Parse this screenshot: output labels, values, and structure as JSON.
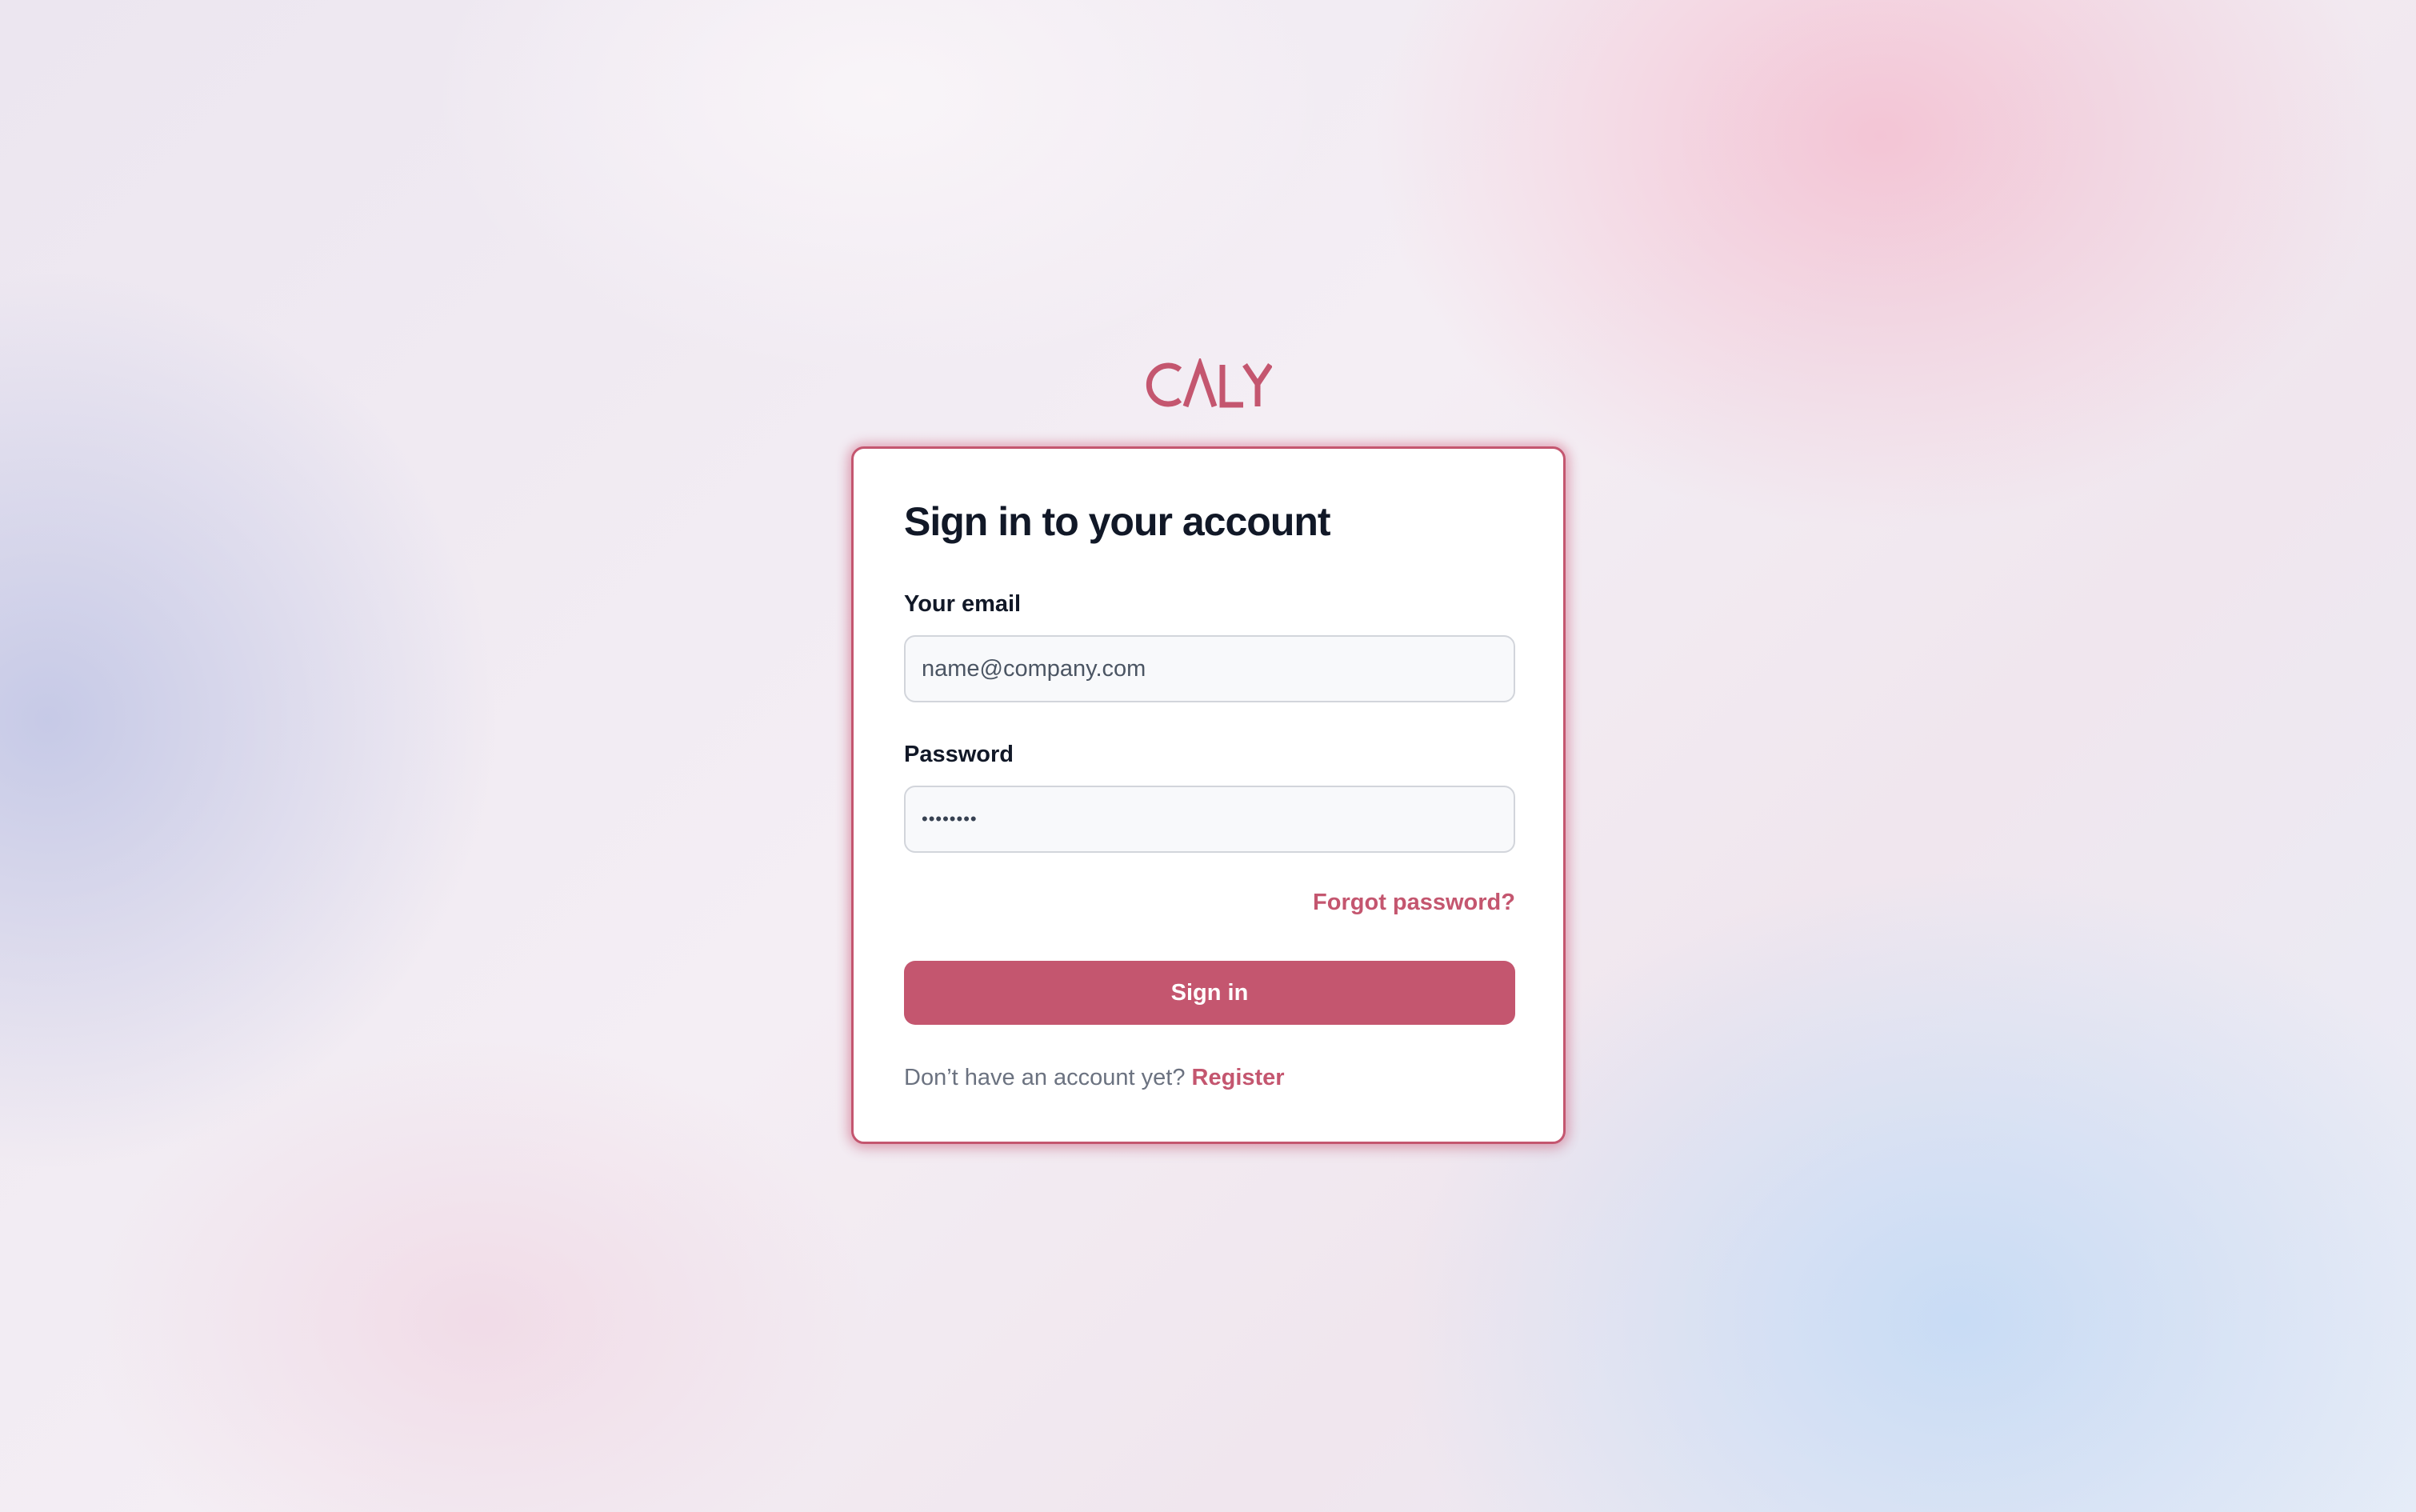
{
  "brand": {
    "logo_text": "CALY",
    "accent_color": "#c4566f"
  },
  "login": {
    "title": "Sign in to your account",
    "email_label": "Your email",
    "email_placeholder": "name@company.com",
    "password_label": "Password",
    "password_value": "••••••••",
    "forgot_password": "Forgot password?",
    "submit_label": "Sign in",
    "no_account_prompt": "Don’t have an account yet?",
    "register_link": "Register"
  }
}
